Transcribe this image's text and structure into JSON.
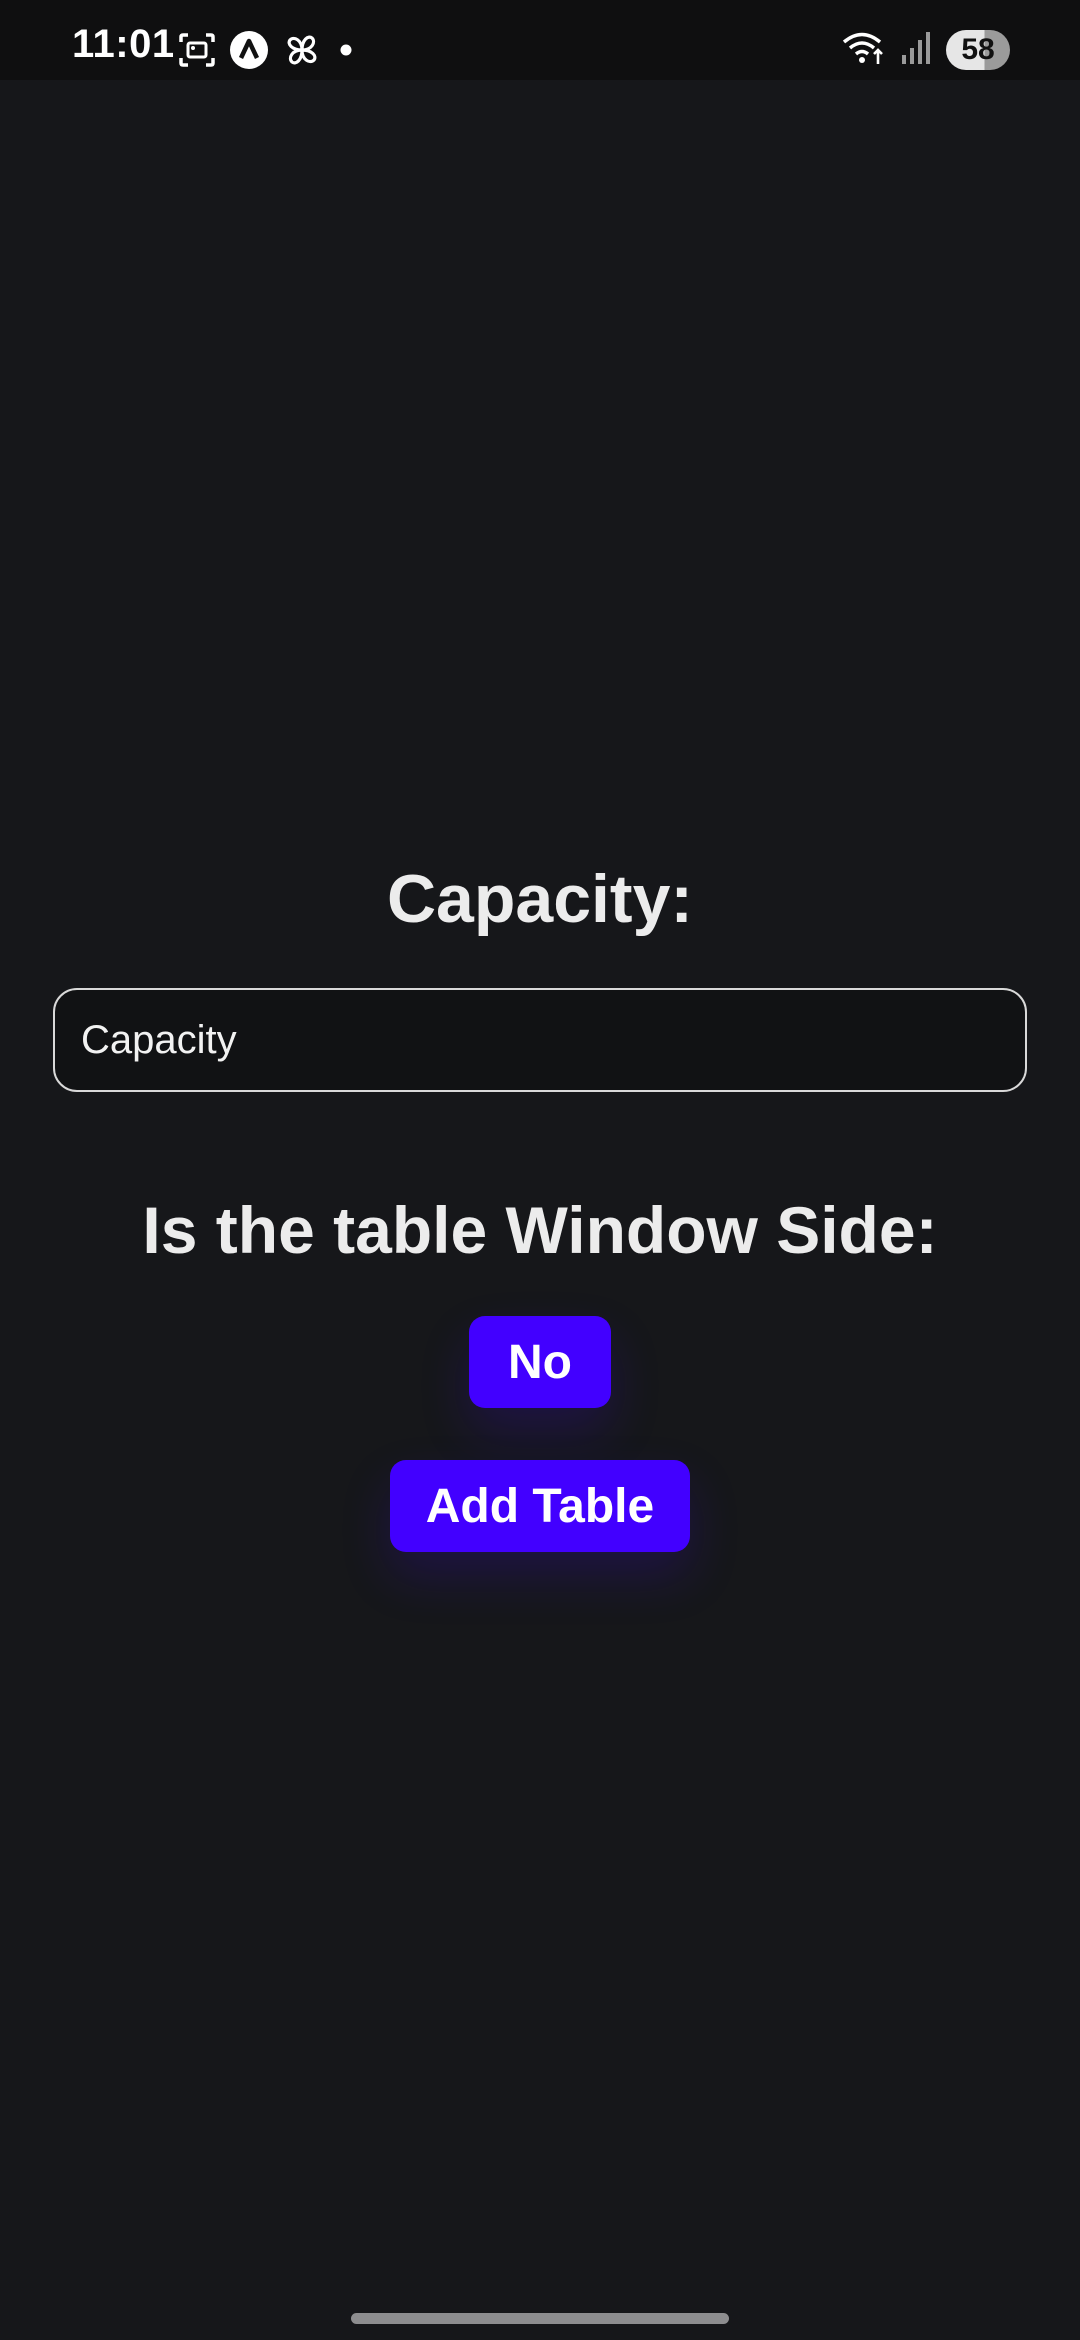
{
  "status_bar": {
    "time": "11:01",
    "battery_level": "58",
    "icons_left": [
      "screenshot-icon",
      "app-a-icon",
      "pinwheel-icon",
      "notification-dot-icon"
    ],
    "icons_right": [
      "wifi-icon",
      "signal-icon",
      "battery-icon"
    ]
  },
  "form": {
    "capacity_heading": "Capacity:",
    "capacity_placeholder": "Capacity",
    "window_heading": "Is the table Window Side:",
    "window_toggle_label": "No",
    "add_button_label": "Add Table"
  },
  "colors": {
    "background": "#16171a",
    "accent": "#4200ff",
    "text": "#ececec"
  }
}
